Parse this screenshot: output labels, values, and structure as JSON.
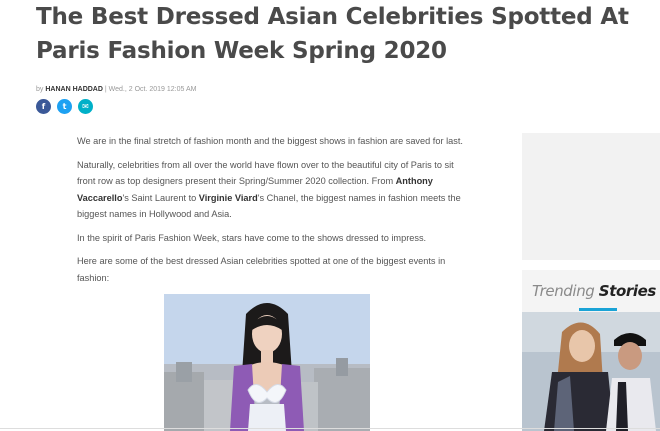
{
  "article": {
    "title": "The Best Dressed Asian Celebrities Spotted At Paris Fashion Week Spring 2020",
    "byline": {
      "prefix": "by",
      "author": "HANAN HADDAD",
      "separator": "|",
      "date": "Wed., 2 Oct. 2019 12:05 AM"
    },
    "share": {
      "facebook_glyph": "f",
      "twitter_glyph": "t",
      "email_glyph": "✉"
    },
    "paragraphs": {
      "p1": "We are in the final stretch of fashion month and the biggest shows in fashion are saved for last.",
      "p2_a": "Naturally, celebrities from all over the world have flown over to the beautiful city of Paris to sit front row as top designers present their Spring/Summer 2020 collection. From ",
      "p2_name1": "Anthony Vaccarello",
      "p2_b": "'s Saint Laurent to ",
      "p2_name2": "Virginie Viard",
      "p2_c": "'s Chanel, the biggest names in fashion meets the biggest names in Hollywood and Asia.",
      "p3": "In the spirit of Paris Fashion Week, stars have come to the shows dressed to impress.",
      "p4": "Here are some of the best dressed Asian celebrities spotted at one of the biggest events in fashion:"
    }
  },
  "sidebar": {
    "trending": {
      "word1": "Trending",
      "word2": "Stories",
      "accent_color": "#1aa3d6"
    }
  },
  "icons": [
    "facebook-icon",
    "twitter-icon",
    "email-icon"
  ]
}
